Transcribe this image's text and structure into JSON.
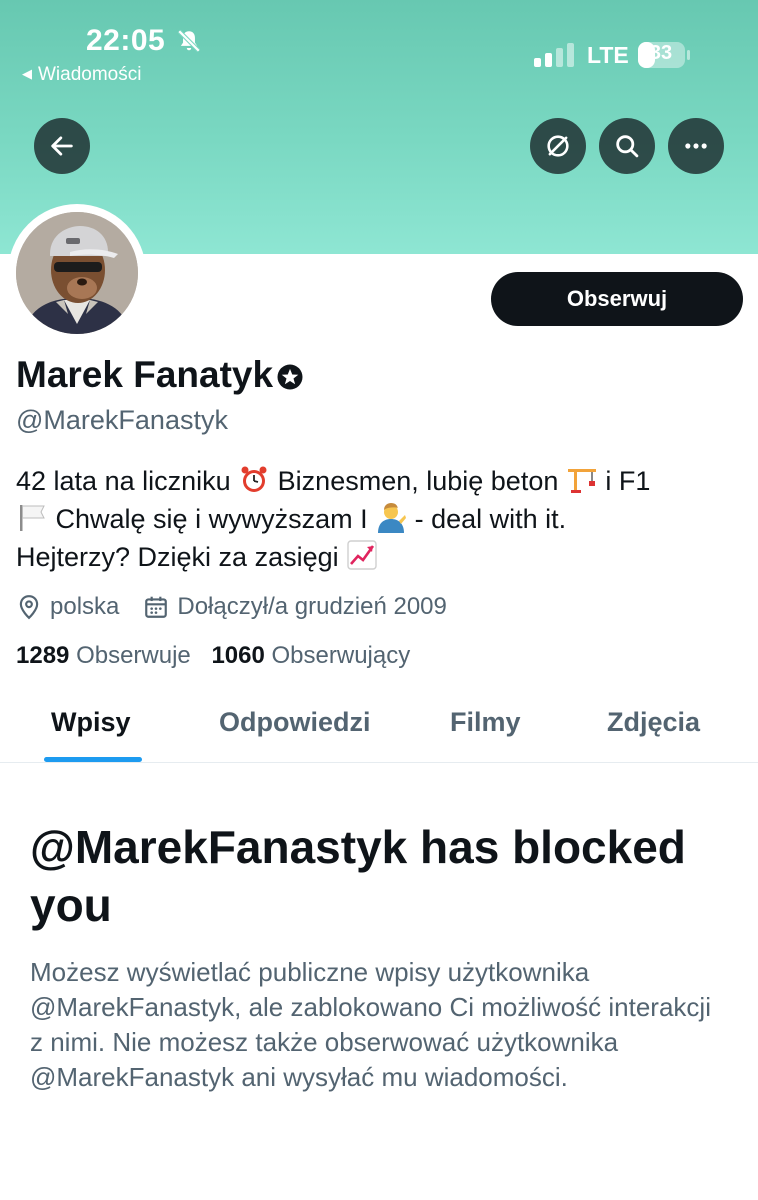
{
  "status_bar": {
    "time": "22:05",
    "back_app": "Wiadomości",
    "network": "LTE",
    "battery": "33",
    "muted_icon": "bell-slash-icon"
  },
  "header": {
    "back_icon": "arrow-left-icon",
    "actions": [
      "eye-slash-icon",
      "search-icon",
      "more-icon"
    ]
  },
  "profile": {
    "name": "Marek Fanatyk",
    "handle": "@MarekFanastyk",
    "follow_label": "Obserwuj",
    "bio": {
      "part1": "42 lata na liczniku",
      "part2": "Biznesmen, lubię beton",
      "part3": "i F1",
      "part4": "Chwalę się i wywyższam I",
      "part5": "- deal with it.",
      "part6": "Hejterzy? Dzięki za zasięgi"
    },
    "location": "polska",
    "joined": "Dołączył/a grudzień 2009",
    "following_count": "1289",
    "following_label": "Obserwuje",
    "followers_count": "1060",
    "followers_label": "Obserwujący"
  },
  "tabs": [
    "Wpisy",
    "Odpowiedzi",
    "Filmy",
    "Zdjęcia"
  ],
  "blocked": {
    "title": "@MarekFanastyk has blocked you",
    "description": "Możesz wyświetlać publiczne wpisy użytkownika @MarekFanastyk, ale zablokowano Ci możliwość interakcji z nimi. Nie możesz także obserwować użytkownika @MarekFanastyk ani wysyłać mu wiadomości."
  },
  "colors": {
    "banner": "#7ad8c2",
    "accent": "#1d9bf0",
    "text": "#0f1419",
    "secondary": "#536471"
  }
}
